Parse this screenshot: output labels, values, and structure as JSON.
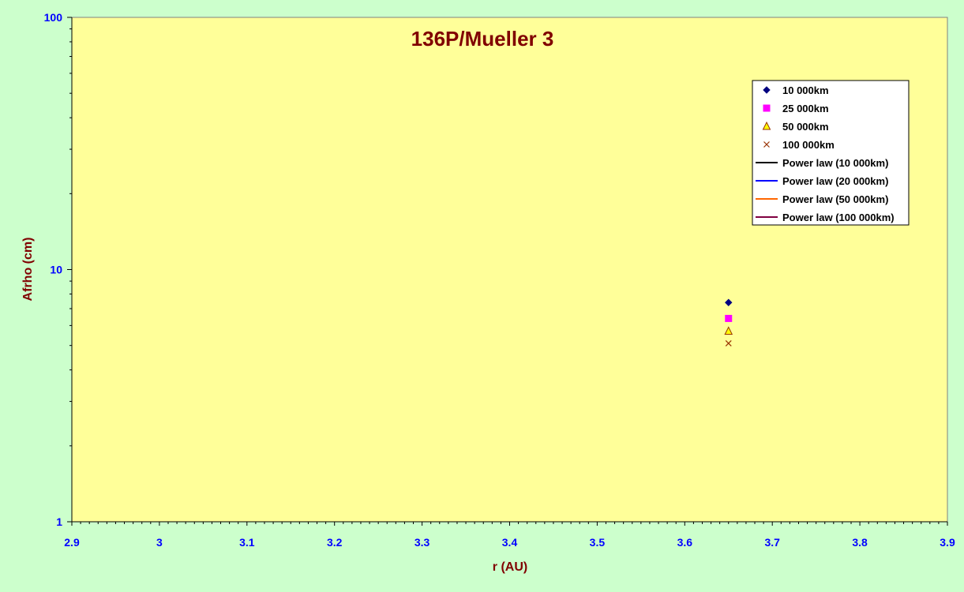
{
  "chart_data": {
    "type": "scatter",
    "title": "136P/Mueller 3",
    "xlabel": "r (AU)",
    "ylabel": "Afrho (cm)",
    "xlim": [
      2.9,
      3.9
    ],
    "ylim": [
      1,
      100
    ],
    "yscale": "log",
    "grid": false,
    "legend_position": "top-right",
    "x_ticks": [
      "2.9",
      "3",
      "3.1",
      "3.2",
      "3.3",
      "3.4",
      "3.5",
      "3.6",
      "3.7",
      "3.8",
      "3.9"
    ],
    "y_ticks": [
      "1",
      "10",
      "100"
    ],
    "series": [
      {
        "name": "10 000km",
        "marker": "diamond",
        "color": "#000080",
        "points": [
          {
            "x": 3.65,
            "y": 7.4
          }
        ]
      },
      {
        "name": "25 000km",
        "marker": "square",
        "color": "#ff00ff",
        "points": [
          {
            "x": 3.65,
            "y": 6.4
          }
        ]
      },
      {
        "name": "50 000km",
        "marker": "triangle",
        "color": "#ffff00",
        "points": [
          {
            "x": 3.65,
            "y": 5.7
          }
        ]
      },
      {
        "name": "100 000km",
        "marker": "x",
        "color": "#993300",
        "points": [
          {
            "x": 3.65,
            "y": 5.1
          }
        ]
      },
      {
        "name": "Power law (10 000km)",
        "marker": "line",
        "color": "#000000",
        "points": []
      },
      {
        "name": "Power law (20 000km)",
        "marker": "line",
        "color": "#0000ff",
        "points": []
      },
      {
        "name": "Power law (50 000km)",
        "marker": "line",
        "color": "#ff6600",
        "points": []
      },
      {
        "name": "Power law (100 000km)",
        "marker": "line",
        "color": "#800040",
        "points": []
      }
    ]
  },
  "colors": {
    "page_background": "#ccffcc",
    "plot_background": "#ffff99",
    "title": "#800000",
    "tick_labels": "#0000ff"
  }
}
